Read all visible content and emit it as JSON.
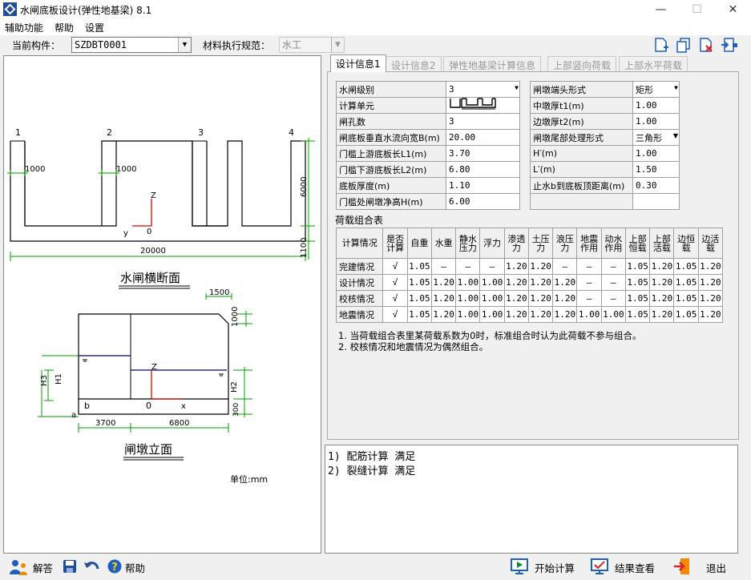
{
  "window": {
    "title": "水闸底板设计(弹性地基梁) 8.1",
    "minimize": "—",
    "maximize": "☐",
    "close": "✕"
  },
  "menu": [
    "辅助功能",
    "帮助",
    "设置"
  ],
  "component": {
    "label": "当前构件：",
    "value": "SZDBT0001",
    "spec_label": "材料执行规范：",
    "spec_value": "水工"
  },
  "tabs": [
    "设计信息1",
    "设计信息2",
    "弹性地基梁计算信息",
    "上部竖向荷载",
    "上部水平荷载"
  ],
  "design_left": [
    {
      "label": "水闸级别",
      "value": "3",
      "dropdown": true
    },
    {
      "label": "计算单元",
      "value": "",
      "pic": true
    },
    {
      "label": "闸孔数",
      "value": "3"
    },
    {
      "label": "闸底板垂直水流向宽B(m)",
      "value": "20.00"
    },
    {
      "label": "门槛上游底板长L1(m)",
      "value": "3.70"
    },
    {
      "label": "门槛下游底板长L2(m)",
      "value": "6.80"
    },
    {
      "label": "底板厚度(m)",
      "value": "1.10"
    },
    {
      "label": "门槛处闸墩净高H(m)",
      "value": "6.00"
    }
  ],
  "design_right": [
    {
      "label": "闸墩端头形式",
      "value": "矩形",
      "dropdown": true
    },
    {
      "label": "中墩厚t1(m)",
      "value": "1.00"
    },
    {
      "label": "边墩厚t2(m)",
      "value": "1.00"
    },
    {
      "label": "闸墩尾部处理形式",
      "value": "三角形",
      "dropdown": true
    },
    {
      "label": "H′(m)",
      "value": "1.00"
    },
    {
      "label": "L′(m)",
      "value": "1.50"
    },
    {
      "label": "止水b到底板顶距离(m)",
      "value": "0.30"
    },
    {
      "label": "",
      "value": ""
    }
  ],
  "load_title": "荷载组合表",
  "load_headers": [
    "计算情况",
    "是否计算",
    "自重",
    "水重",
    "静水压力",
    "浮力",
    "渗透力",
    "土压力",
    "浪压力",
    "地震作用",
    "动水作用",
    "上部恒载",
    "上部活载",
    "边恒载",
    "边活载"
  ],
  "load_rows": [
    [
      "完建情况",
      "√",
      "1.05",
      "—",
      "—",
      "—",
      "1.20",
      "1.20",
      "—",
      "—",
      "—",
      "1.05",
      "1.20",
      "1.05",
      "1.20"
    ],
    [
      "设计情况",
      "√",
      "1.05",
      "1.20",
      "1.00",
      "1.00",
      "1.20",
      "1.20",
      "1.20",
      "—",
      "—",
      "1.05",
      "1.20",
      "1.05",
      "1.20"
    ],
    [
      "校核情况",
      "√",
      "1.05",
      "1.20",
      "1.00",
      "1.00",
      "1.20",
      "1.20",
      "1.20",
      "—",
      "—",
      "1.05",
      "1.20",
      "1.05",
      "1.20"
    ],
    [
      "地震情况",
      "√",
      "1.05",
      "1.20",
      "1.00",
      "1.00",
      "1.20",
      "1.20",
      "1.20",
      "1.00",
      "1.00",
      "1.05",
      "1.20",
      "1.05",
      "1.20"
    ]
  ],
  "notes": [
    "1. 当荷载组合表里某荷载系数为0时，标准组合时认为此荷载不参与组合。",
    "2. 校核情况和地震情况为偶然组合。"
  ],
  "results": [
    "1) 配筋计算  满足",
    "2) 裂缝计算  满足"
  ],
  "drawing": {
    "cross_title": "水闸横断面",
    "elev_title": "闸墩立面",
    "unit": "单位:mm",
    "pier_nums": [
      "1",
      "2",
      "3",
      "4"
    ],
    "dim_pier": "1000",
    "dim_width": "20000",
    "dim_height": "6000",
    "dim_thick": "1100",
    "dim_tail_l": "1500",
    "dim_tail_h": "1000",
    "dim_l1": "3700",
    "dim_l2": "6800",
    "lab_h3": "H3",
    "lab_h1": "H1",
    "lab_h2": "H2",
    "dim_side": "300",
    "lab_z": "Z",
    "lab_y": "y",
    "lab_x": "x",
    "lab_o": "0",
    "lab_b": "b",
    "lab_a": "a"
  },
  "bottom": {
    "answer": "解答",
    "help": "帮助",
    "start": "开始计算",
    "view": "结果查看",
    "exit": "退出"
  }
}
